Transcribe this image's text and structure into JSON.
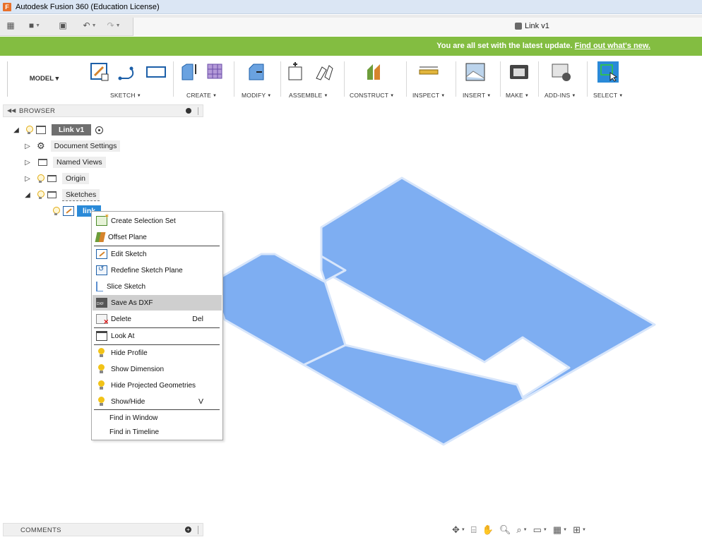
{
  "window": {
    "title": "Autodesk Fusion 360 (Education License)"
  },
  "document_tab": {
    "label": "Link v1"
  },
  "banner": {
    "message": "You are all set with the latest update.",
    "link": "Find out what's new."
  },
  "toolbar": {
    "workspace": "MODEL ▾",
    "groups": {
      "sketch": "SKETCH",
      "create": "CREATE",
      "modify": "MODIFY",
      "assemble": "ASSEMBLE",
      "construct": "CONSTRUCT",
      "inspect": "INSPECT",
      "insert": "INSERT",
      "make": "MAKE",
      "addins": "ADD-INS",
      "select": "SELECT"
    }
  },
  "browser": {
    "header": "BROWSER",
    "root": "Link v1",
    "items": {
      "document_settings": "Document Settings",
      "named_views": "Named Views",
      "origin": "Origin",
      "sketches": "Sketches",
      "link_sketch": "link"
    }
  },
  "context_menu": {
    "create_selection_set": "Create Selection Set",
    "offset_plane": "Offset Plane",
    "edit_sketch": "Edit Sketch",
    "redefine_sketch_plane": "Redefine Sketch Plane",
    "slice_sketch": "Slice Sketch",
    "save_as_dxf": "Save As DXF",
    "delete": "Delete",
    "delete_shortcut": "Del",
    "look_at": "Look At",
    "hide_profile": "Hide Profile",
    "show_dimension": "Show Dimension",
    "hide_projected": "Hide Projected Geometries",
    "show_hide": "Show/Hide",
    "show_hide_shortcut": "V",
    "find_in_window": "Find in Window",
    "find_in_timeline": "Find in Timeline"
  },
  "comments": {
    "label": "COMMENTS"
  },
  "colors": {
    "banner": "#83bd41",
    "profile_fill": "#7eaef2",
    "profile_stroke": "#dce8fb",
    "selection": "#2a8ad8"
  }
}
